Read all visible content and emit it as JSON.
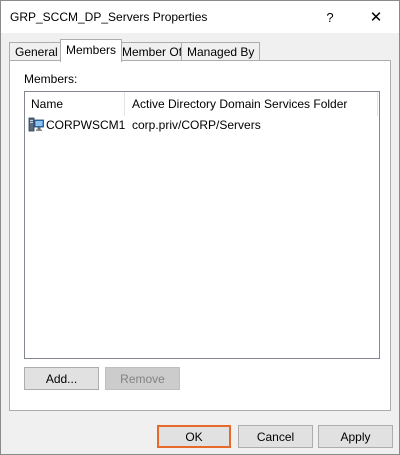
{
  "window": {
    "title": "GRP_SCCM_DP_Servers Properties",
    "help_glyph": "?",
    "close_glyph": "✕"
  },
  "tabs": [
    {
      "label": "General",
      "active": false
    },
    {
      "label": "Members",
      "active": true
    },
    {
      "label": "Member Of",
      "active": false
    },
    {
      "label": "Managed By",
      "active": false
    }
  ],
  "members": {
    "label": "Members:",
    "columns": [
      "Name",
      "Active Directory Domain Services Folder"
    ],
    "rows": [
      {
        "name": "CORPWSCM1",
        "folder": "corp.priv/CORP/Servers",
        "icon": "computer-icon"
      }
    ],
    "add_label": "Add...",
    "remove_label": "Remove"
  },
  "footer": {
    "ok_label": "OK",
    "cancel_label": "Cancel",
    "apply_label": "Apply"
  },
  "colors": {
    "default_button_border": "#e86a2b",
    "dialog_background": "#f0f0f0"
  }
}
